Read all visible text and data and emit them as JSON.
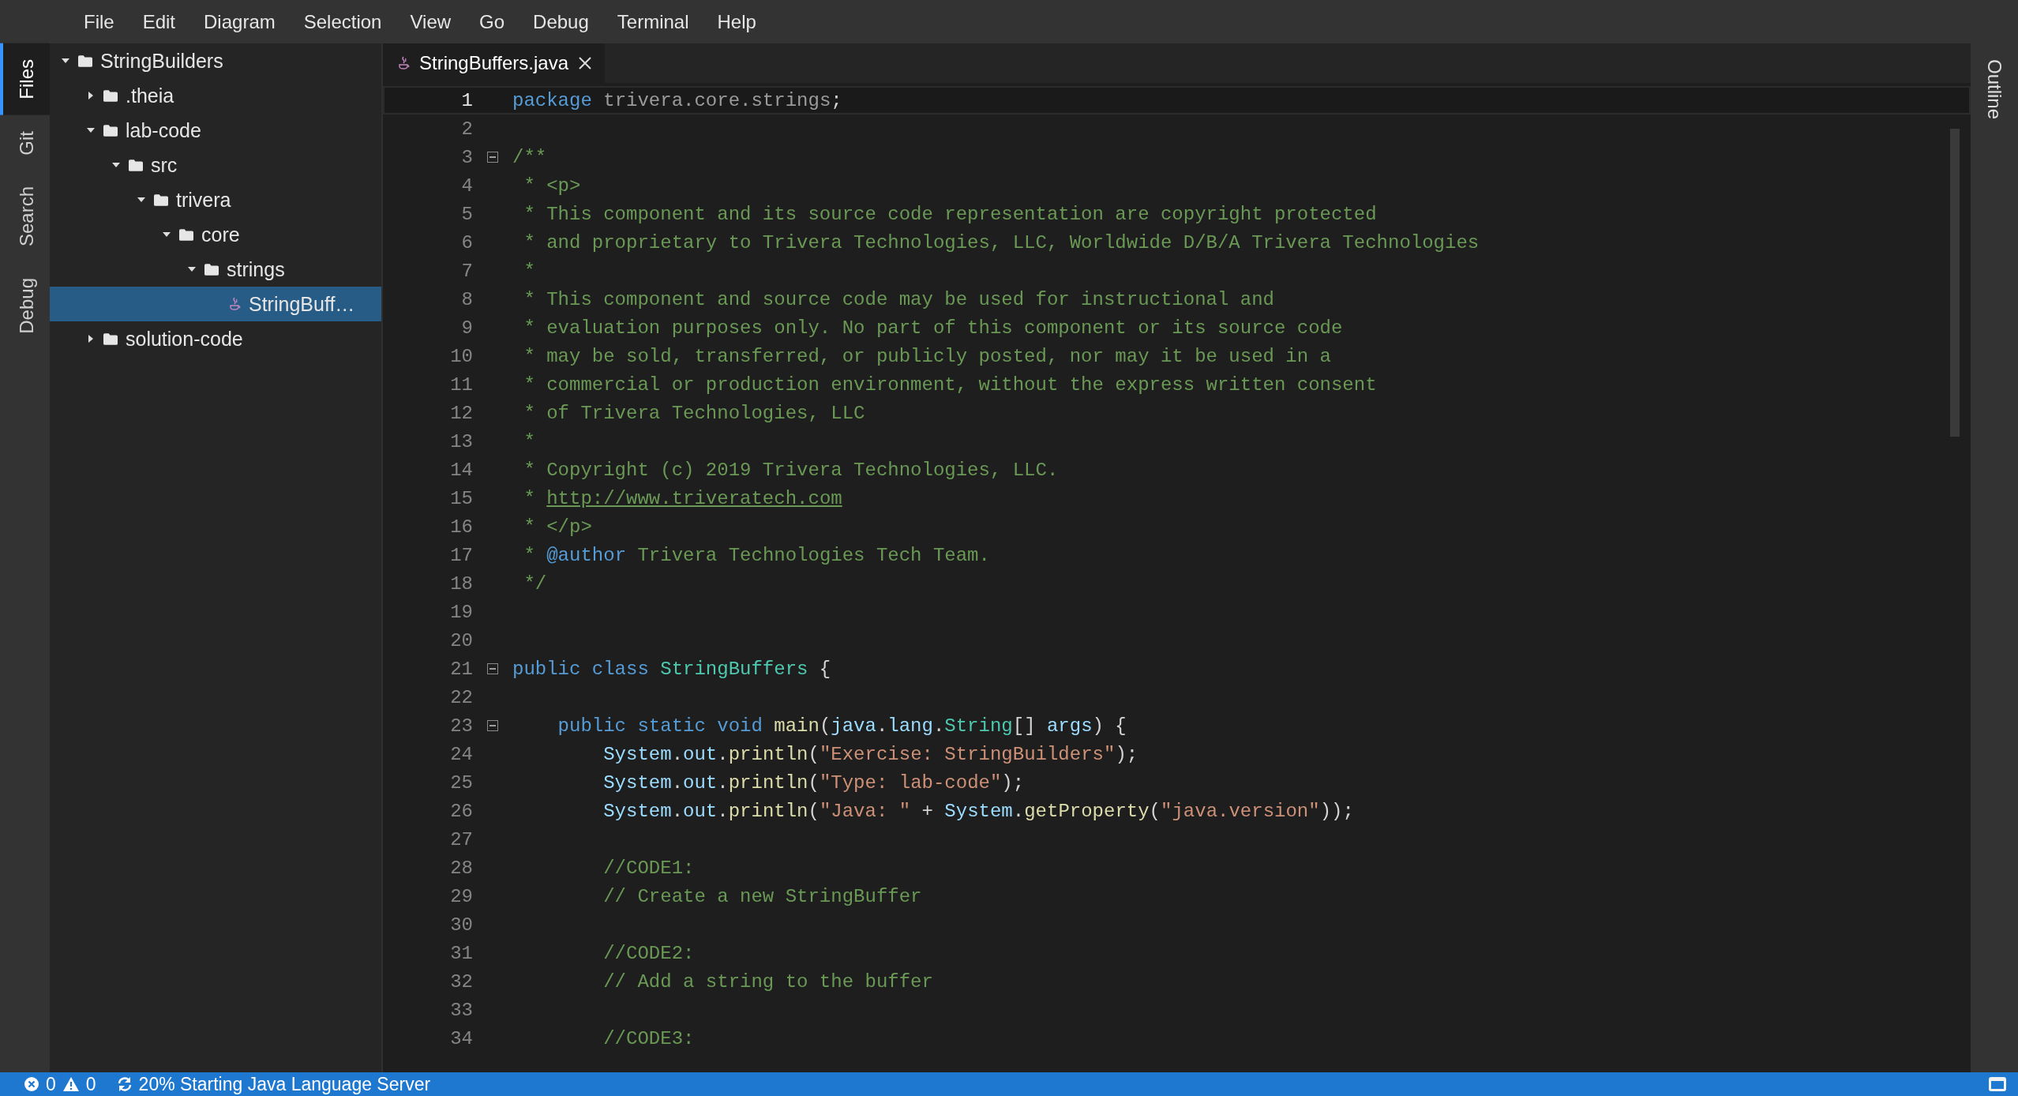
{
  "menu": [
    "File",
    "Edit",
    "Diagram",
    "Selection",
    "View",
    "Go",
    "Debug",
    "Terminal",
    "Help"
  ],
  "activity_tabs": [
    {
      "label": "Files",
      "selected": true
    },
    {
      "label": "Git",
      "selected": false
    },
    {
      "label": "Search",
      "selected": false
    },
    {
      "label": "Debug",
      "selected": false
    }
  ],
  "tree": [
    {
      "label": "StringBuilders",
      "kind": "folder",
      "expanded": true,
      "selected": false,
      "children": [
        {
          "label": ".theia",
          "kind": "folder",
          "expanded": false,
          "selected": false
        },
        {
          "label": "lab-code",
          "kind": "folder",
          "expanded": true,
          "selected": false,
          "children": [
            {
              "label": "src",
              "kind": "folder",
              "expanded": true,
              "selected": false,
              "children": [
                {
                  "label": "trivera",
                  "kind": "folder",
                  "expanded": true,
                  "selected": false,
                  "children": [
                    {
                      "label": "core",
                      "kind": "folder",
                      "expanded": true,
                      "selected": false,
                      "children": [
                        {
                          "label": "strings",
                          "kind": "folder",
                          "expanded": true,
                          "selected": false,
                          "children": [
                            {
                              "label": "StringBuff…",
                              "kind": "java",
                              "selected": true
                            }
                          ]
                        }
                      ]
                    }
                  ]
                }
              ]
            }
          ]
        },
        {
          "label": "solution-code",
          "kind": "folder",
          "expanded": false,
          "selected": false
        }
      ]
    }
  ],
  "editor_tab": {
    "label": "StringBuffers.java",
    "selected": true
  },
  "lines": [
    {
      "number": "1",
      "current": true,
      "fold": false,
      "tokens": [
        {
          "kind": "keyword",
          "text": "package"
        },
        {
          "kind": "dim",
          "text": " trivera.core.strings"
        },
        {
          "kind": "plain",
          "text": ";"
        }
      ]
    },
    {
      "number": "2",
      "current": false,
      "fold": false
    },
    {
      "number": "3",
      "current": false,
      "fold": true,
      "tokens": [
        {
          "kind": "comment",
          "text": "/**"
        }
      ]
    },
    {
      "number": "4",
      "current": false,
      "fold": false,
      "tokens": [
        {
          "kind": "comment",
          "text": " * <p>"
        }
      ]
    },
    {
      "number": "5",
      "current": false,
      "fold": false,
      "tokens": [
        {
          "kind": "comment",
          "text": " * This component and its source code representation are copyright protected"
        }
      ]
    },
    {
      "number": "6",
      "current": false,
      "fold": false,
      "tokens": [
        {
          "kind": "comment",
          "text": " * and proprietary to Trivera Technologies, LLC, Worldwide D/B/A Trivera Technologies"
        }
      ]
    },
    {
      "number": "7",
      "current": false,
      "fold": false,
      "tokens": [
        {
          "kind": "comment",
          "text": " *"
        }
      ]
    },
    {
      "number": "8",
      "current": false,
      "fold": false,
      "tokens": [
        {
          "kind": "comment",
          "text": " * This component and source code may be used for instructional and"
        }
      ]
    },
    {
      "number": "9",
      "current": false,
      "fold": false,
      "tokens": [
        {
          "kind": "comment",
          "text": " * evaluation purposes only. No part of this component or its source code"
        }
      ]
    },
    {
      "number": "10",
      "current": false,
      "fold": false,
      "tokens": [
        {
          "kind": "comment",
          "text": " * may be sold, transferred, or publicly posted, nor may it be used in a"
        }
      ]
    },
    {
      "number": "11",
      "current": false,
      "fold": false,
      "tokens": [
        {
          "kind": "comment",
          "text": " * commercial or production environment, without the express written consent"
        }
      ]
    },
    {
      "number": "12",
      "current": false,
      "fold": false,
      "tokens": [
        {
          "kind": "comment",
          "text": " * of Trivera Technologies, LLC"
        }
      ]
    },
    {
      "number": "13",
      "current": false,
      "fold": false,
      "tokens": [
        {
          "kind": "comment",
          "text": " *"
        }
      ]
    },
    {
      "number": "14",
      "current": false,
      "fold": false,
      "tokens": [
        {
          "kind": "comment",
          "text": " * Copyright (c) 2019 Trivera Technologies, LLC."
        }
      ]
    },
    {
      "number": "15",
      "current": false,
      "fold": false,
      "tokens": [
        {
          "kind": "comment",
          "text": " * "
        },
        {
          "kind": "link",
          "text": "http://www.triveratech.com"
        }
      ]
    },
    {
      "number": "16",
      "current": false,
      "fold": false,
      "tokens": [
        {
          "kind": "comment",
          "text": " * </p>"
        }
      ]
    },
    {
      "number": "17",
      "current": false,
      "fold": false,
      "tokens": [
        {
          "kind": "comment",
          "text": " * "
        },
        {
          "kind": "keyword",
          "text": "@author"
        },
        {
          "kind": "comment",
          "text": " Trivera Technologies Tech Team."
        }
      ]
    },
    {
      "number": "18",
      "current": false,
      "fold": false,
      "tokens": [
        {
          "kind": "comment",
          "text": " */"
        }
      ]
    },
    {
      "number": "19",
      "current": false,
      "fold": false
    },
    {
      "number": "20",
      "current": false,
      "fold": false
    },
    {
      "number": "21",
      "current": false,
      "fold": true,
      "tokens": [
        {
          "kind": "keyword",
          "text": "public class"
        },
        {
          "kind": "type",
          "text": " StringBuffers"
        },
        {
          "kind": "plain",
          "text": " {"
        }
      ]
    },
    {
      "number": "22",
      "current": false,
      "fold": false
    },
    {
      "number": "23",
      "current": false,
      "fold": true,
      "tokens": [
        {
          "kind": "keyword",
          "text": "    public static void"
        },
        {
          "kind": "func",
          "text": " main"
        },
        {
          "kind": "plain",
          "text": "("
        },
        {
          "kind": "variable",
          "text": "java"
        },
        {
          "kind": "plain",
          "text": "."
        },
        {
          "kind": "variable",
          "text": "lang"
        },
        {
          "kind": "plain",
          "text": "."
        },
        {
          "kind": "type",
          "text": "String"
        },
        {
          "kind": "plain",
          "text": "[] "
        },
        {
          "kind": "variable",
          "text": "args"
        },
        {
          "kind": "plain",
          "text": ") {"
        }
      ]
    },
    {
      "number": "24",
      "current": false,
      "fold": false,
      "tokens": [
        {
          "kind": "variable",
          "text": "        System"
        },
        {
          "kind": "plain",
          "text": "."
        },
        {
          "kind": "variable",
          "text": "out"
        },
        {
          "kind": "plain",
          "text": "."
        },
        {
          "kind": "func",
          "text": "println"
        },
        {
          "kind": "plain",
          "text": "("
        },
        {
          "kind": "string",
          "text": "\"Exercise: StringBuilders\""
        },
        {
          "kind": "plain",
          "text": ");"
        }
      ]
    },
    {
      "number": "25",
      "current": false,
      "fold": false,
      "tokens": [
        {
          "kind": "variable",
          "text": "        System"
        },
        {
          "kind": "plain",
          "text": "."
        },
        {
          "kind": "variable",
          "text": "out"
        },
        {
          "kind": "plain",
          "text": "."
        },
        {
          "kind": "func",
          "text": "println"
        },
        {
          "kind": "plain",
          "text": "("
        },
        {
          "kind": "string",
          "text": "\"Type: lab-code\""
        },
        {
          "kind": "plain",
          "text": ");"
        }
      ]
    },
    {
      "number": "26",
      "current": false,
      "fold": false,
      "tokens": [
        {
          "kind": "variable",
          "text": "        System"
        },
        {
          "kind": "plain",
          "text": "."
        },
        {
          "kind": "variable",
          "text": "out"
        },
        {
          "kind": "plain",
          "text": "."
        },
        {
          "kind": "func",
          "text": "println"
        },
        {
          "kind": "plain",
          "text": "("
        },
        {
          "kind": "string",
          "text": "\"Java: \""
        },
        {
          "kind": "plain",
          "text": " + "
        },
        {
          "kind": "variable",
          "text": "System"
        },
        {
          "kind": "plain",
          "text": "."
        },
        {
          "kind": "func",
          "text": "getProperty"
        },
        {
          "kind": "plain",
          "text": "("
        },
        {
          "kind": "string",
          "text": "\"java.version\""
        },
        {
          "kind": "plain",
          "text": "));"
        }
      ]
    },
    {
      "number": "27",
      "current": false,
      "fold": false
    },
    {
      "number": "28",
      "current": false,
      "fold": false,
      "tokens": [
        {
          "kind": "comment",
          "text": "        //CODE1:"
        }
      ]
    },
    {
      "number": "29",
      "current": false,
      "fold": false,
      "tokens": [
        {
          "kind": "comment",
          "text": "        // Create a new StringBuffer"
        }
      ]
    },
    {
      "number": "30",
      "current": false,
      "fold": false
    },
    {
      "number": "31",
      "current": false,
      "fold": false,
      "tokens": [
        {
          "kind": "comment",
          "text": "        //CODE2:"
        }
      ]
    },
    {
      "number": "32",
      "current": false,
      "fold": false,
      "tokens": [
        {
          "kind": "comment",
          "text": "        // Add a string to the buffer"
        }
      ]
    },
    {
      "number": "33",
      "current": false,
      "fold": false
    },
    {
      "number": "34",
      "current": false,
      "fold": false,
      "tokens": [
        {
          "kind": "comment",
          "text": "        //CODE3:"
        }
      ]
    }
  ],
  "right_tabs": [
    {
      "label": "Outline",
      "selected": false
    }
  ],
  "status_bar": {
    "errors": "0",
    "warnings": "0",
    "progress": "20% Starting Java Language Server"
  }
}
